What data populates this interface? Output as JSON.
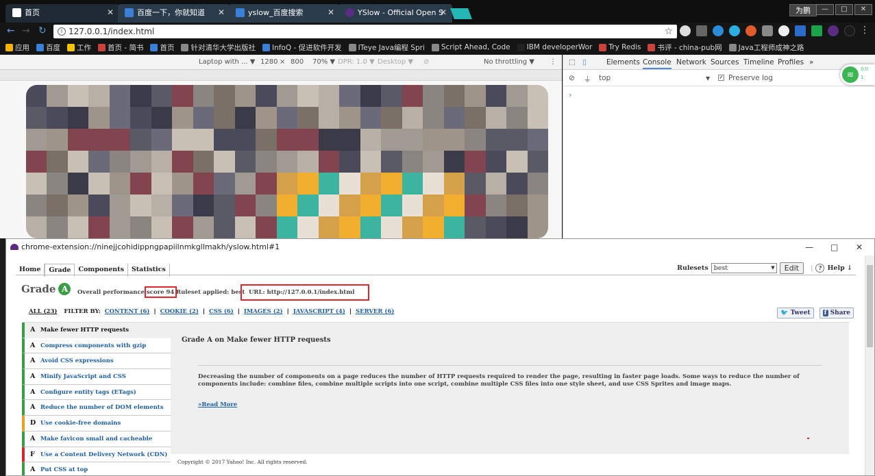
{
  "tabs": [
    {
      "label": "首页",
      "active": true
    },
    {
      "label": "百度一下，你就知道"
    },
    {
      "label": "yslow_百度搜索"
    },
    {
      "label": "YSlow - Official Open S"
    }
  ],
  "window": {
    "user": "为鹏",
    "min": "—",
    "max": "□",
    "close": "✕"
  },
  "address": {
    "url": "127.0.0.1/index.html"
  },
  "bookmarks": [
    {
      "label": "应用",
      "color": "#f5b400"
    },
    {
      "label": "百度",
      "color": "#3a7fd8"
    },
    {
      "label": "工作",
      "color": "#f5c400"
    },
    {
      "label": "首页 - 简书",
      "color": "#c9423b"
    },
    {
      "label": "首页",
      "color": "#3a7fd8"
    },
    {
      "label": "针对清华大学出版社",
      "color": "#888"
    },
    {
      "label": "InfoQ - 促进软件开发",
      "color": "#3a7fd8"
    },
    {
      "label": "ITeye Java编程 Spri",
      "color": "#888"
    },
    {
      "label": "Script Ahead, Code",
      "color": "#888"
    },
    {
      "label": "IBM developerWor",
      "color": "#222"
    },
    {
      "label": "Try Redis",
      "color": "#c9423b"
    },
    {
      "label": "书评 - china-pub网",
      "color": "#c9423b"
    },
    {
      "label": "Java工程师成神之路",
      "color": "#888"
    }
  ],
  "device_toolbar": {
    "device": "Laptop with ... ▼",
    "width": "1280",
    "times": "×",
    "height": "800",
    "zoom": "70% ▼",
    "dpr": "DPR: 1.0 ▼",
    "mode": "Desktop ▼",
    "throttle": "No throttling ▼"
  },
  "devtools": {
    "tabs": [
      "Elements",
      "Console",
      "Network",
      "Sources",
      "Timeline",
      "Profiles",
      "»"
    ],
    "active_tab": "Console",
    "context": "top",
    "preserve_log": "Preserve log",
    "prompt": "›"
  },
  "wifi": {
    "up": "0.0",
    "down": "1"
  },
  "yslow": {
    "title": "chrome-extension://ninejjcohidippngpapiilnmkgllmakh/yslow.html#1",
    "tabs": [
      "Home",
      "Grade",
      "Components",
      "Statistics"
    ],
    "active_tab": "Grade",
    "rulesets_label": "Rulesets",
    "ruleset_value": "best",
    "edit": "Edit",
    "help": "Help ↓",
    "grade_word": "Grade",
    "grade": "A",
    "overall_score": "Overall performance score 94",
    "ruleset_applied": "Ruleset applied: best",
    "url": "URL: http://127.0.0.1/index.html",
    "filters": {
      "all": "ALL (23)",
      "by": "FILTER BY:",
      "items": [
        "CONTENT (6)",
        "COOKIE (2)",
        "CSS (6)",
        "IMAGES (2)",
        "JAVASCRIPT (4)",
        "SERVER (6)"
      ]
    },
    "tweet": "Tweet",
    "share": "Share",
    "rules": [
      {
        "grade": "A",
        "label": "Make fewer HTTP requests",
        "selected": true
      },
      {
        "grade": "A",
        "label": "Compress components with gzip"
      },
      {
        "grade": "A",
        "label": "Avoid CSS expressions"
      },
      {
        "grade": "A",
        "label": "Minify JavaScript and CSS"
      },
      {
        "grade": "A",
        "label": "Configure entity tags (ETags)"
      },
      {
        "grade": "A",
        "label": "Reduce the number of DOM elements"
      },
      {
        "grade": "D",
        "label": "Use cookie-free domains"
      },
      {
        "grade": "A",
        "label": "Make favicon small and cacheable"
      },
      {
        "grade": "F",
        "label": "Use a Content Delivery Network (CDN)"
      },
      {
        "grade": "A",
        "label": "Put CSS at top"
      }
    ],
    "detail": {
      "heading": "Grade A on Make fewer HTTP requests",
      "body": "Decreasing the number of components on a page reduces the number of HTTP requests required to render the page, resulting in faster page loads. Some ways to reduce the number of components include: combine files, combine multiple scripts into one script, combine multiple CSS files into one style sheet, and use CSS Sprites and image maps.",
      "read_more": "»Read More"
    },
    "footer": "Copyright © 2017 Yahoo! Inc. All rights reserved."
  }
}
